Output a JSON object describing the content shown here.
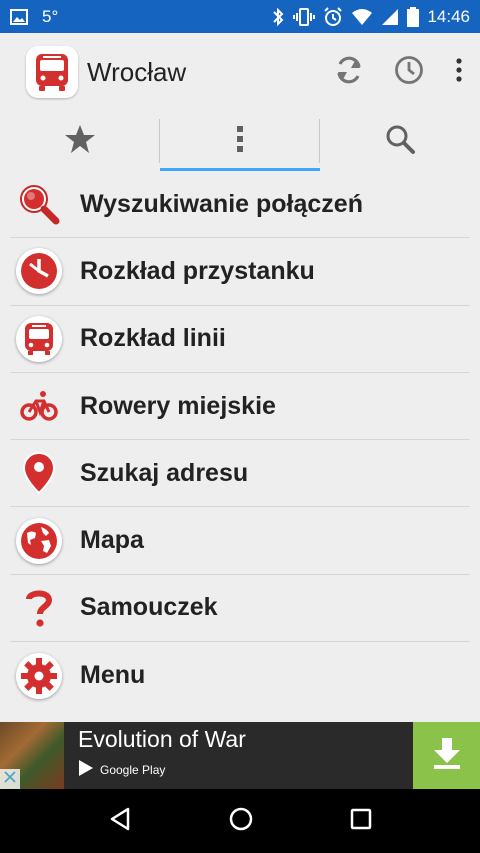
{
  "status_bar": {
    "temperature": "5°",
    "time": "14:46"
  },
  "app_bar": {
    "title": "Wrocław"
  },
  "tabs": [
    {
      "icon": "star-icon"
    },
    {
      "icon": "more-vert-icon",
      "active": true
    },
    {
      "icon": "search-icon"
    }
  ],
  "menu": [
    {
      "label": "Wyszukiwanie połączeń",
      "icon": "magnifier-icon"
    },
    {
      "label": "Rozkład przystanku",
      "icon": "clock-icon"
    },
    {
      "label": "Rozkład linii",
      "icon": "bus-icon"
    },
    {
      "label": "Rowery miejskie",
      "icon": "bicycle-icon"
    },
    {
      "label": "Szukaj adresu",
      "icon": "map-pin-icon"
    },
    {
      "label": "Mapa",
      "icon": "globe-icon"
    },
    {
      "label": "Samouczek",
      "icon": "question-icon"
    },
    {
      "label": "Menu",
      "icon": "gear-icon"
    }
  ],
  "ad": {
    "title": "Evolution of War",
    "store": "Google Play"
  },
  "colors": {
    "status_bar": "#1565c0",
    "accent_red": "#d32f2f",
    "tab_indicator": "#42a5f5",
    "ad_download": "#8bc34a"
  }
}
